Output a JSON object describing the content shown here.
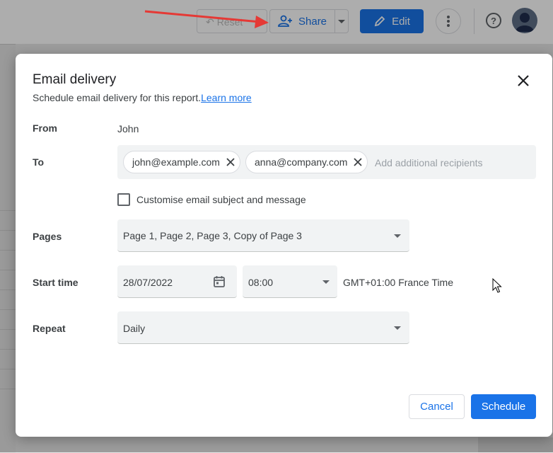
{
  "toolbar": {
    "reset_label": "Reset",
    "share_label": "Share",
    "edit_label": "Edit"
  },
  "dialog": {
    "title": "Email delivery",
    "subtitle": "Schedule email delivery for this report.",
    "learn_more": "Learn more",
    "from_label": "From",
    "from_value": "John",
    "to_label": "To",
    "recipients": [
      "john@example.com",
      "anna@company.com"
    ],
    "add_recipients_placeholder": "Add additional recipients",
    "customise_label": "Customise email subject and message",
    "customise_checked": false,
    "pages_label": "Pages",
    "pages_value": "Page 1, Page 2, Page 3, Copy of Page 3",
    "start_time_label": "Start time",
    "start_date": "28/07/2022",
    "start_time": "08:00",
    "timezone": "GMT+01:00 France Time",
    "repeat_label": "Repeat",
    "repeat_value": "Daily",
    "cancel_label": "Cancel",
    "schedule_label": "Schedule"
  },
  "colors": {
    "accent": "#1a73e8",
    "annotation_arrow": "#e53935"
  }
}
